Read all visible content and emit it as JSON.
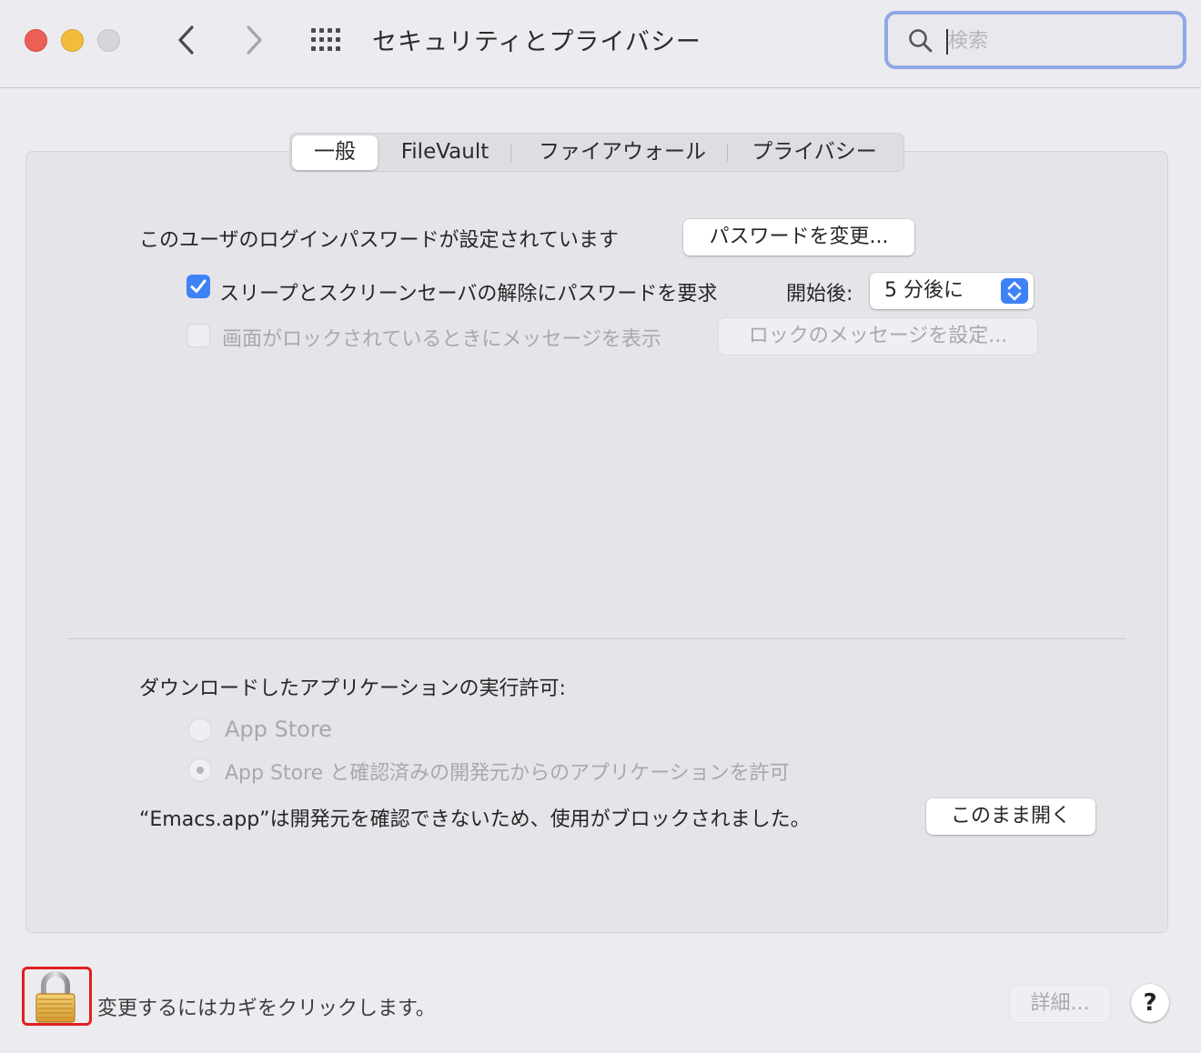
{
  "window": {
    "title": "セキュリティとプライバシー",
    "search_placeholder": "検索"
  },
  "tabs": [
    {
      "label": "一般",
      "active": true
    },
    {
      "label": "FileVault",
      "active": false
    },
    {
      "label": "ファイアウォール",
      "active": false
    },
    {
      "label": "プライバシー",
      "active": false
    }
  ],
  "general": {
    "password_status": "このユーザのログインパスワードが設定されています",
    "change_password_button": "パスワードを変更...",
    "require_password_label": "スリープとスクリーンセーバの解除にパスワードを要求",
    "require_password_checked": true,
    "after_label": "開始後:",
    "after_value": "5 分後に",
    "show_message_label": "画面がロックされているときにメッセージを表示",
    "show_message_checked": false,
    "set_lock_message_button": "ロックのメッセージを設定..."
  },
  "downloads": {
    "heading": "ダウンロードしたアプリケーションの実行許可:",
    "options": [
      {
        "label": "App Store",
        "selected": false
      },
      {
        "label": "App Store と確認済みの開発元からのアプリケーションを許可",
        "selected": true
      }
    ],
    "blocked_message": "“Emacs.app”は開発元を確認できないため、使用がブロックされました。",
    "open_anyway_button": "このまま開く"
  },
  "footer": {
    "lock_text": "変更するにはカギをクリックします。",
    "advanced_button": "詳細...",
    "help_button": "?"
  },
  "colors": {
    "accent": "#3f82f6",
    "highlight_box": "#e02020"
  }
}
